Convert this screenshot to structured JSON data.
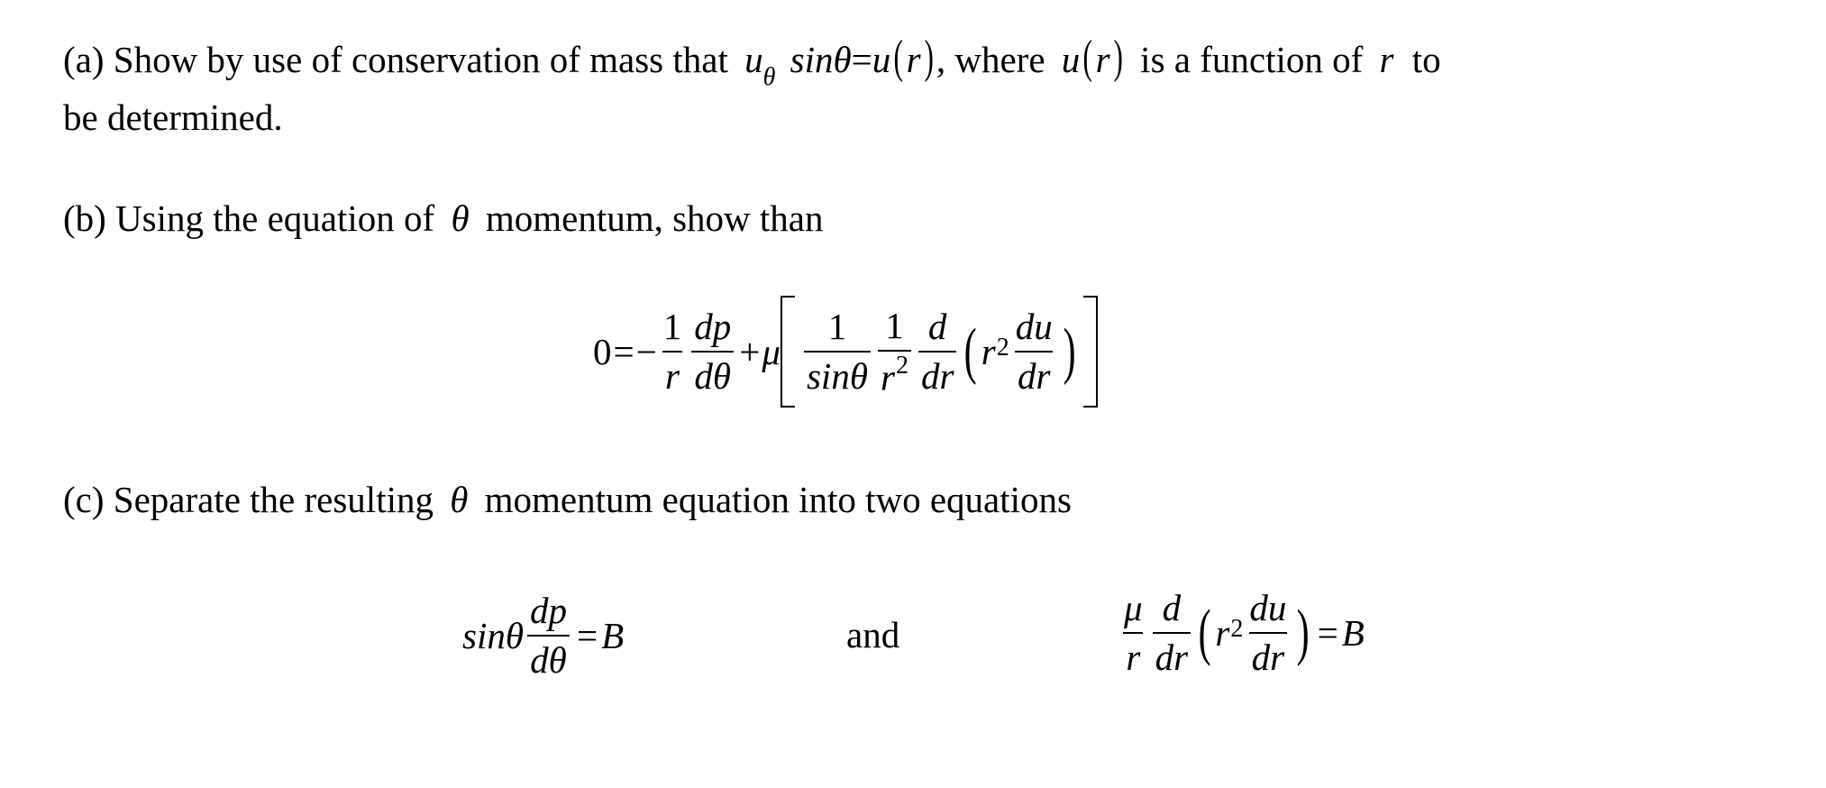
{
  "part_a": {
    "label": "(a)",
    "text_before": "Show by use of conservation of mass that",
    "u_theta": "u",
    "theta_sub": "θ",
    "sin_theta": "sinθ",
    "equals": "=",
    "u_of_r": "u",
    "r_var": "r",
    "text_middle": ", where",
    "text_after": "is a function of",
    "text_end": "to",
    "line2": "be determined."
  },
  "part_b": {
    "label": "(b)",
    "text_before": "Using the equation of",
    "theta": "θ",
    "text_after": "momentum, show than",
    "equation": {
      "lhs": "0",
      "equals": "=",
      "minus": "−",
      "frac1_num": "1",
      "frac1_den": "r",
      "frac2_num": "dp",
      "frac2_den": "dθ",
      "plus": "+",
      "mu": "μ",
      "frac3_num": "1",
      "frac3_den": "sinθ",
      "frac4_num": "1",
      "frac4_den_base": "r",
      "frac4_den_exp": "2",
      "frac5_num": "d",
      "frac5_den": "dr",
      "r_base": "r",
      "r_exp": "2",
      "frac6_num": "du",
      "frac6_den": "dr"
    }
  },
  "part_c": {
    "label": "(c)",
    "text_before": "Separate the resulting",
    "theta": "θ",
    "text_after": "momentum equation into two equations",
    "eq1": {
      "sin_theta": "sinθ",
      "frac_num": "dp",
      "frac_den": "dθ",
      "equals": "=",
      "rhs": "B"
    },
    "connector": "and",
    "eq2": {
      "frac1_num": "μ",
      "frac1_den": "r",
      "frac2_num": "d",
      "frac2_den": "dr",
      "r_base": "r",
      "r_exp": "2",
      "frac3_num": "du",
      "frac3_den": "dr",
      "equals": "=",
      "rhs": "B"
    }
  }
}
